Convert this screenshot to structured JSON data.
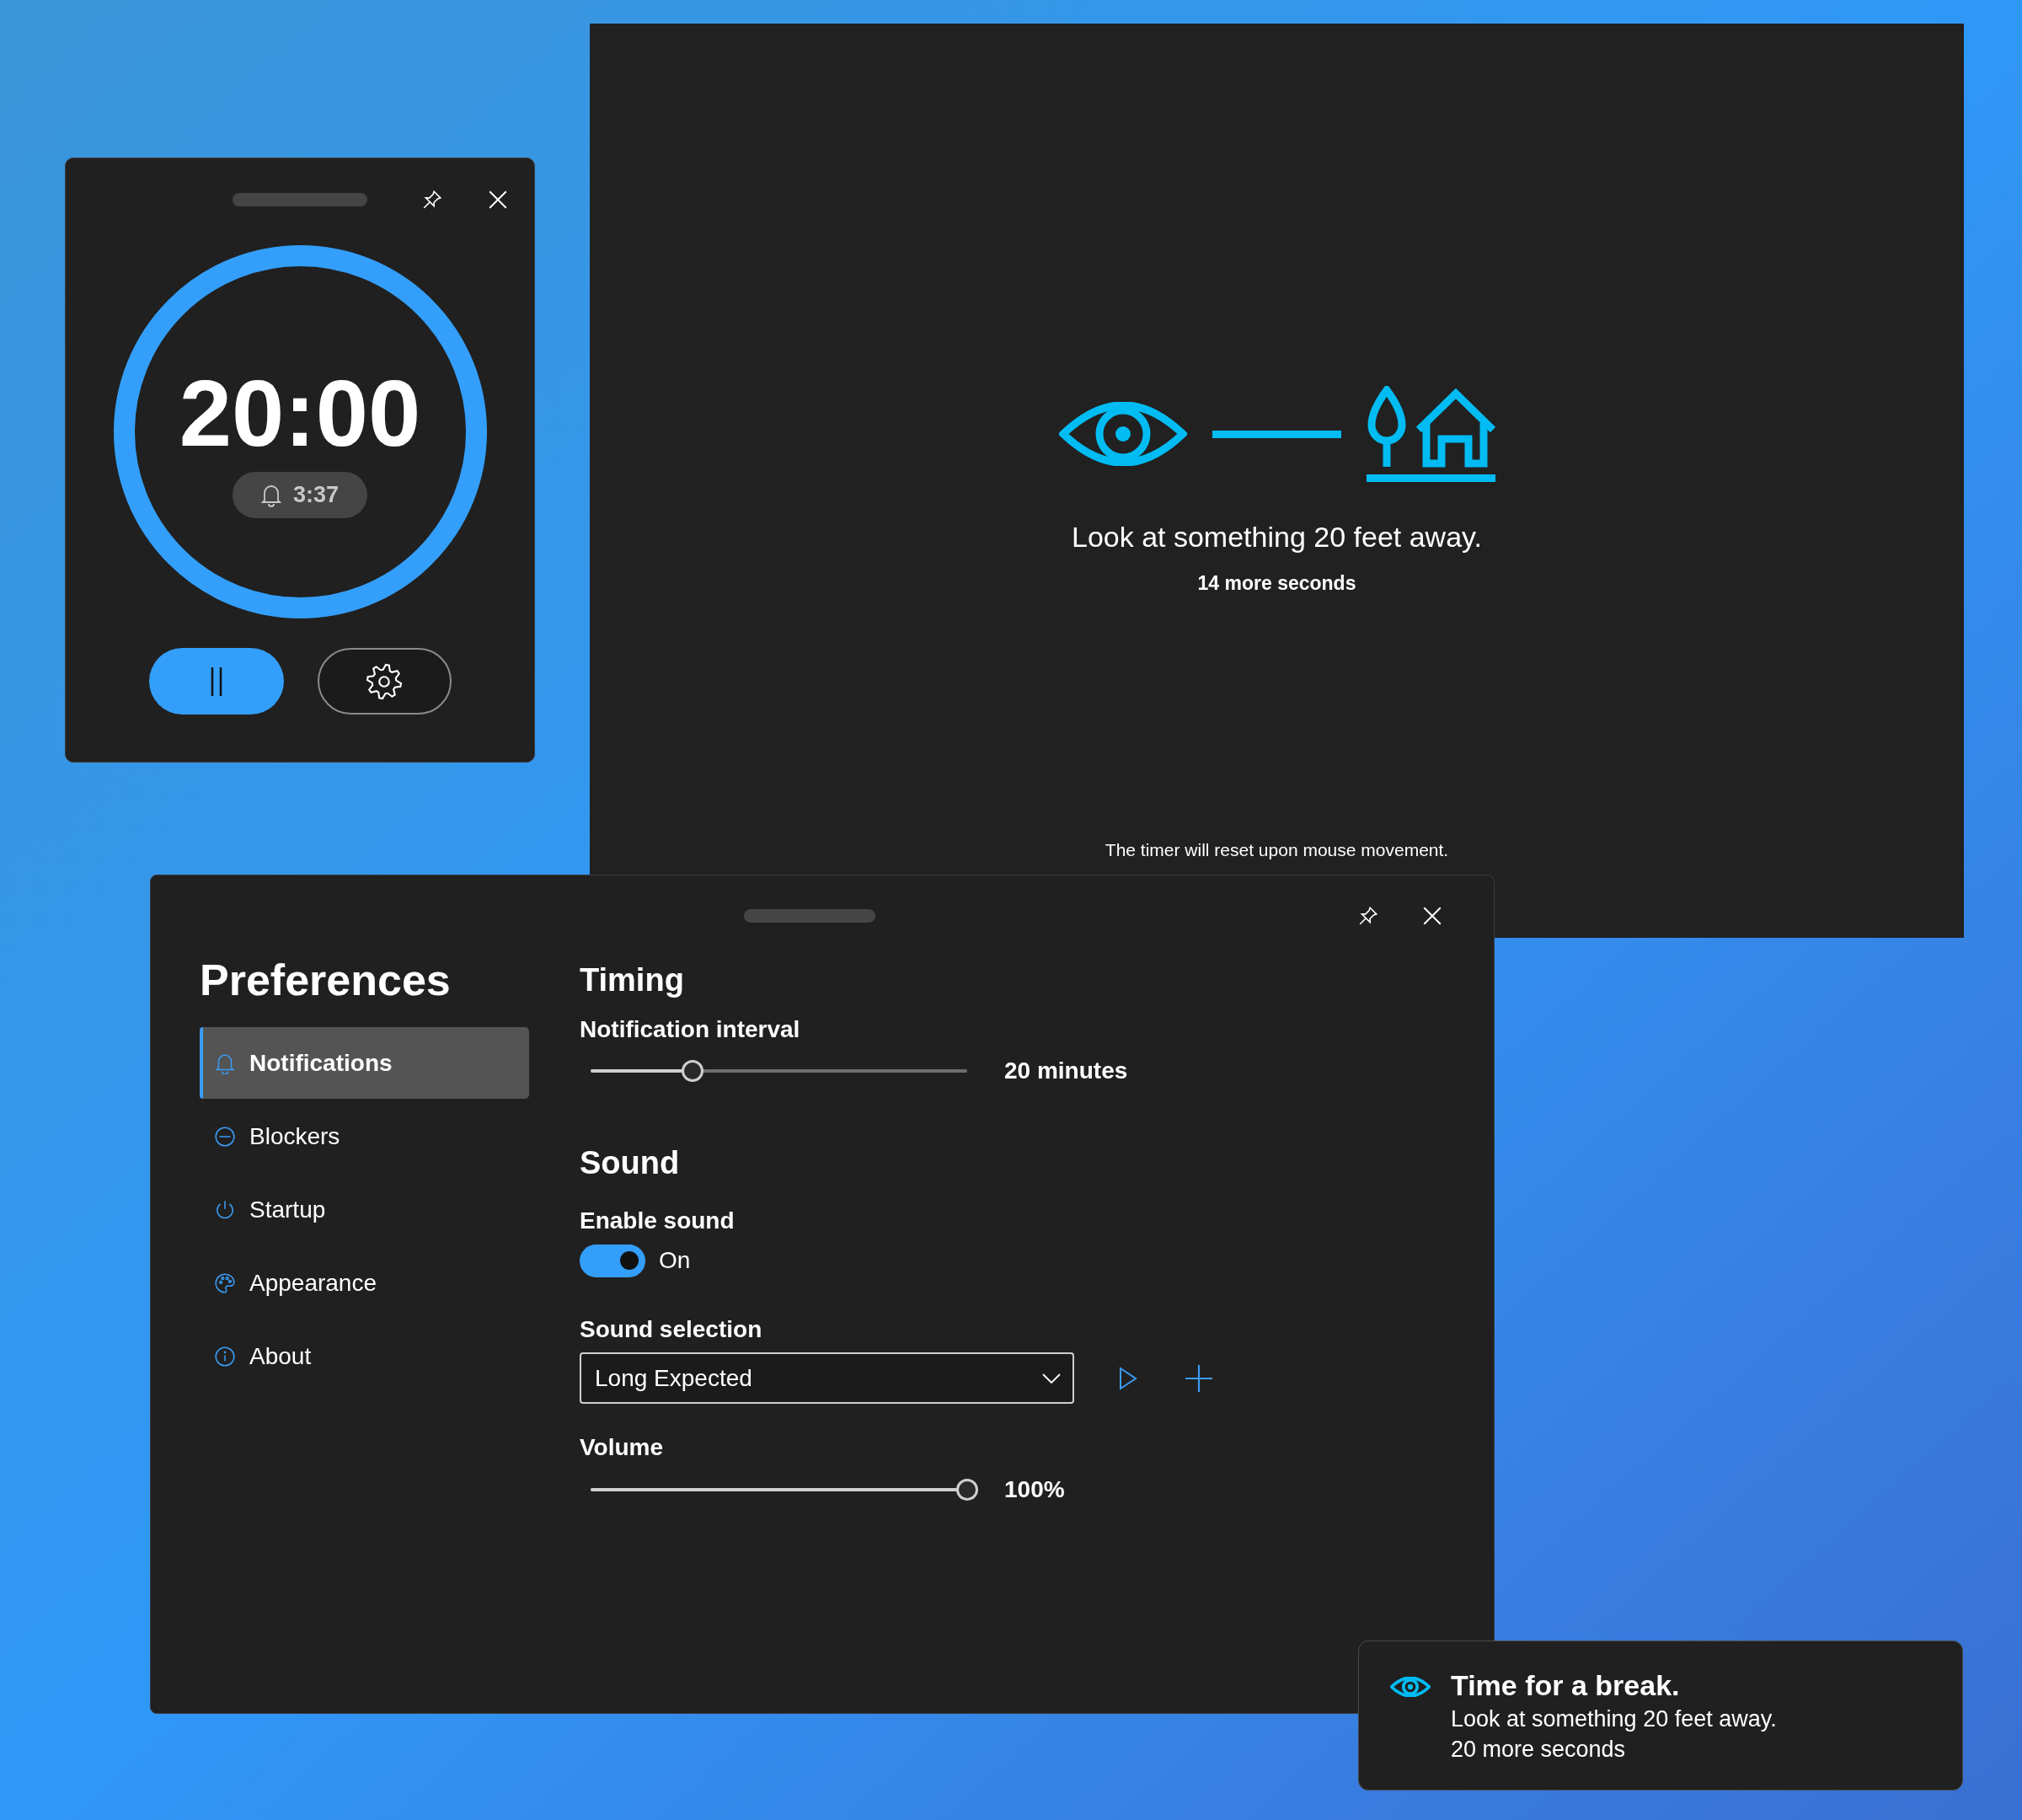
{
  "timer_window": {
    "time": "20:00",
    "next_alarm": "3:37"
  },
  "break_overlay": {
    "message": "Look at something 20 feet away.",
    "countdown": "14 more seconds",
    "footer": "The timer will reset upon mouse movement."
  },
  "preferences": {
    "title": "Preferences",
    "nav": [
      {
        "label": "Notifications",
        "selected": true
      },
      {
        "label": "Blockers",
        "selected": false
      },
      {
        "label": "Startup",
        "selected": false
      },
      {
        "label": "Appearance",
        "selected": false
      },
      {
        "label": "About",
        "selected": false
      }
    ],
    "timing": {
      "heading": "Timing",
      "interval": {
        "label": "Notification interval",
        "level": 0.27,
        "reading": "20 minutes"
      }
    },
    "sound": {
      "heading": "Sound",
      "enable": {
        "label": "Enable sound",
        "on": true,
        "state_text": "On"
      },
      "selection": {
        "label": "Sound selection",
        "value": "Long Expected"
      },
      "volume": {
        "label": "Volume",
        "level": 1.0,
        "reading": "100%"
      }
    }
  },
  "toast": {
    "title": "Time for a break.",
    "message": "Look at something 20 feet away.",
    "countdown": "20 more seconds"
  }
}
